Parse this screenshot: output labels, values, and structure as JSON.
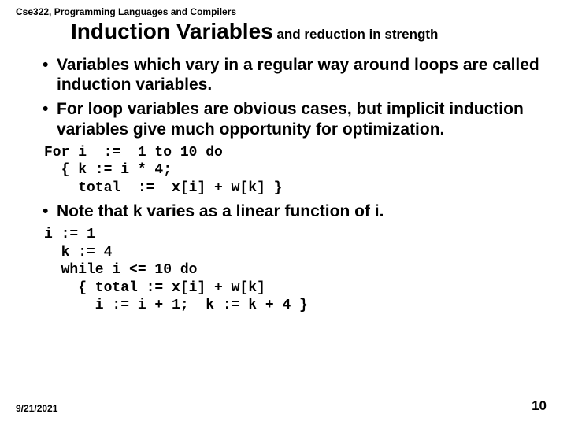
{
  "header": {
    "course": "Cse322, Programming Languages and Compilers"
  },
  "title": {
    "main": "Induction Variables",
    "sub": " and reduction in strength"
  },
  "bullets": {
    "b1": "Variables which vary in a regular way around loops are called induction variables.",
    "b2": "For loop variables are obvious cases, but implicit induction variables give much opportunity for optimization.",
    "b3": "Note that k varies  as a linear function of i."
  },
  "code": {
    "block1": "For i  :=  1 to 10 do\n  { k := i * 4;\n    total  :=  x[i] + w[k] }",
    "block2": "i := 1\n  k := 4\n  while i <= 10 do\n    { total := x[i] + w[k]\n      i := i + 1;  k := k + 4 }"
  },
  "footer": {
    "date": "9/21/2021",
    "page": "10"
  }
}
